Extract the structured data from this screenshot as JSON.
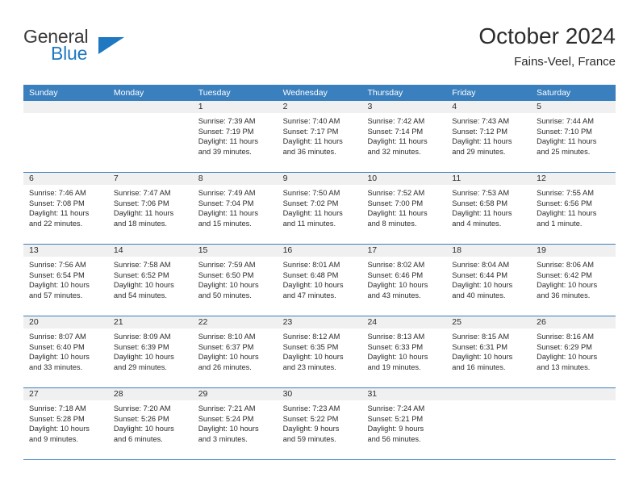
{
  "brand": {
    "name_part1": "General",
    "name_part2": "Blue",
    "logo_icon": "blue-triangle",
    "color_dark": "#3a3a3a",
    "color_blue": "#1f78c1"
  },
  "header": {
    "title": "October 2024",
    "subtitle": "Fains-Veel, France"
  },
  "theme": {
    "header_blue": "#3a7fbe",
    "date_band_gray": "#f0f0f0",
    "row_divider": "#3a7fbe",
    "text": "#2b2b2b"
  },
  "weekdays": [
    "Sunday",
    "Monday",
    "Tuesday",
    "Wednesday",
    "Thursday",
    "Friday",
    "Saturday"
  ],
  "labels": {
    "sunrise_prefix": "Sunrise:",
    "sunset_prefix": "Sunset:",
    "daylight_prefix": "Daylight:"
  },
  "weeks": [
    [
      {
        "day": "",
        "sunrise": "",
        "sunset": "",
        "daylight_line1": "",
        "daylight_line2": ""
      },
      {
        "day": "",
        "sunrise": "",
        "sunset": "",
        "daylight_line1": "",
        "daylight_line2": ""
      },
      {
        "day": "1",
        "sunrise": "Sunrise: 7:39 AM",
        "sunset": "Sunset: 7:19 PM",
        "daylight_line1": "Daylight: 11 hours",
        "daylight_line2": "and 39 minutes."
      },
      {
        "day": "2",
        "sunrise": "Sunrise: 7:40 AM",
        "sunset": "Sunset: 7:17 PM",
        "daylight_line1": "Daylight: 11 hours",
        "daylight_line2": "and 36 minutes."
      },
      {
        "day": "3",
        "sunrise": "Sunrise: 7:42 AM",
        "sunset": "Sunset: 7:14 PM",
        "daylight_line1": "Daylight: 11 hours",
        "daylight_line2": "and 32 minutes."
      },
      {
        "day": "4",
        "sunrise": "Sunrise: 7:43 AM",
        "sunset": "Sunset: 7:12 PM",
        "daylight_line1": "Daylight: 11 hours",
        "daylight_line2": "and 29 minutes."
      },
      {
        "day": "5",
        "sunrise": "Sunrise: 7:44 AM",
        "sunset": "Sunset: 7:10 PM",
        "daylight_line1": "Daylight: 11 hours",
        "daylight_line2": "and 25 minutes."
      }
    ],
    [
      {
        "day": "6",
        "sunrise": "Sunrise: 7:46 AM",
        "sunset": "Sunset: 7:08 PM",
        "daylight_line1": "Daylight: 11 hours",
        "daylight_line2": "and 22 minutes."
      },
      {
        "day": "7",
        "sunrise": "Sunrise: 7:47 AM",
        "sunset": "Sunset: 7:06 PM",
        "daylight_line1": "Daylight: 11 hours",
        "daylight_line2": "and 18 minutes."
      },
      {
        "day": "8",
        "sunrise": "Sunrise: 7:49 AM",
        "sunset": "Sunset: 7:04 PM",
        "daylight_line1": "Daylight: 11 hours",
        "daylight_line2": "and 15 minutes."
      },
      {
        "day": "9",
        "sunrise": "Sunrise: 7:50 AM",
        "sunset": "Sunset: 7:02 PM",
        "daylight_line1": "Daylight: 11 hours",
        "daylight_line2": "and 11 minutes."
      },
      {
        "day": "10",
        "sunrise": "Sunrise: 7:52 AM",
        "sunset": "Sunset: 7:00 PM",
        "daylight_line1": "Daylight: 11 hours",
        "daylight_line2": "and 8 minutes."
      },
      {
        "day": "11",
        "sunrise": "Sunrise: 7:53 AM",
        "sunset": "Sunset: 6:58 PM",
        "daylight_line1": "Daylight: 11 hours",
        "daylight_line2": "and 4 minutes."
      },
      {
        "day": "12",
        "sunrise": "Sunrise: 7:55 AM",
        "sunset": "Sunset: 6:56 PM",
        "daylight_line1": "Daylight: 11 hours",
        "daylight_line2": "and 1 minute."
      }
    ],
    [
      {
        "day": "13",
        "sunrise": "Sunrise: 7:56 AM",
        "sunset": "Sunset: 6:54 PM",
        "daylight_line1": "Daylight: 10 hours",
        "daylight_line2": "and 57 minutes."
      },
      {
        "day": "14",
        "sunrise": "Sunrise: 7:58 AM",
        "sunset": "Sunset: 6:52 PM",
        "daylight_line1": "Daylight: 10 hours",
        "daylight_line2": "and 54 minutes."
      },
      {
        "day": "15",
        "sunrise": "Sunrise: 7:59 AM",
        "sunset": "Sunset: 6:50 PM",
        "daylight_line1": "Daylight: 10 hours",
        "daylight_line2": "and 50 minutes."
      },
      {
        "day": "16",
        "sunrise": "Sunrise: 8:01 AM",
        "sunset": "Sunset: 6:48 PM",
        "daylight_line1": "Daylight: 10 hours",
        "daylight_line2": "and 47 minutes."
      },
      {
        "day": "17",
        "sunrise": "Sunrise: 8:02 AM",
        "sunset": "Sunset: 6:46 PM",
        "daylight_line1": "Daylight: 10 hours",
        "daylight_line2": "and 43 minutes."
      },
      {
        "day": "18",
        "sunrise": "Sunrise: 8:04 AM",
        "sunset": "Sunset: 6:44 PM",
        "daylight_line1": "Daylight: 10 hours",
        "daylight_line2": "and 40 minutes."
      },
      {
        "day": "19",
        "sunrise": "Sunrise: 8:06 AM",
        "sunset": "Sunset: 6:42 PM",
        "daylight_line1": "Daylight: 10 hours",
        "daylight_line2": "and 36 minutes."
      }
    ],
    [
      {
        "day": "20",
        "sunrise": "Sunrise: 8:07 AM",
        "sunset": "Sunset: 6:40 PM",
        "daylight_line1": "Daylight: 10 hours",
        "daylight_line2": "and 33 minutes."
      },
      {
        "day": "21",
        "sunrise": "Sunrise: 8:09 AM",
        "sunset": "Sunset: 6:39 PM",
        "daylight_line1": "Daylight: 10 hours",
        "daylight_line2": "and 29 minutes."
      },
      {
        "day": "22",
        "sunrise": "Sunrise: 8:10 AM",
        "sunset": "Sunset: 6:37 PM",
        "daylight_line1": "Daylight: 10 hours",
        "daylight_line2": "and 26 minutes."
      },
      {
        "day": "23",
        "sunrise": "Sunrise: 8:12 AM",
        "sunset": "Sunset: 6:35 PM",
        "daylight_line1": "Daylight: 10 hours",
        "daylight_line2": "and 23 minutes."
      },
      {
        "day": "24",
        "sunrise": "Sunrise: 8:13 AM",
        "sunset": "Sunset: 6:33 PM",
        "daylight_line1": "Daylight: 10 hours",
        "daylight_line2": "and 19 minutes."
      },
      {
        "day": "25",
        "sunrise": "Sunrise: 8:15 AM",
        "sunset": "Sunset: 6:31 PM",
        "daylight_line1": "Daylight: 10 hours",
        "daylight_line2": "and 16 minutes."
      },
      {
        "day": "26",
        "sunrise": "Sunrise: 8:16 AM",
        "sunset": "Sunset: 6:29 PM",
        "daylight_line1": "Daylight: 10 hours",
        "daylight_line2": "and 13 minutes."
      }
    ],
    [
      {
        "day": "27",
        "sunrise": "Sunrise: 7:18 AM",
        "sunset": "Sunset: 5:28 PM",
        "daylight_line1": "Daylight: 10 hours",
        "daylight_line2": "and 9 minutes."
      },
      {
        "day": "28",
        "sunrise": "Sunrise: 7:20 AM",
        "sunset": "Sunset: 5:26 PM",
        "daylight_line1": "Daylight: 10 hours",
        "daylight_line2": "and 6 minutes."
      },
      {
        "day": "29",
        "sunrise": "Sunrise: 7:21 AM",
        "sunset": "Sunset: 5:24 PM",
        "daylight_line1": "Daylight: 10 hours",
        "daylight_line2": "and 3 minutes."
      },
      {
        "day": "30",
        "sunrise": "Sunrise: 7:23 AM",
        "sunset": "Sunset: 5:22 PM",
        "daylight_line1": "Daylight: 9 hours",
        "daylight_line2": "and 59 minutes."
      },
      {
        "day": "31",
        "sunrise": "Sunrise: 7:24 AM",
        "sunset": "Sunset: 5:21 PM",
        "daylight_line1": "Daylight: 9 hours",
        "daylight_line2": "and 56 minutes."
      },
      {
        "day": "",
        "sunrise": "",
        "sunset": "",
        "daylight_line1": "",
        "daylight_line2": ""
      },
      {
        "day": "",
        "sunrise": "",
        "sunset": "",
        "daylight_line1": "",
        "daylight_line2": ""
      }
    ]
  ]
}
